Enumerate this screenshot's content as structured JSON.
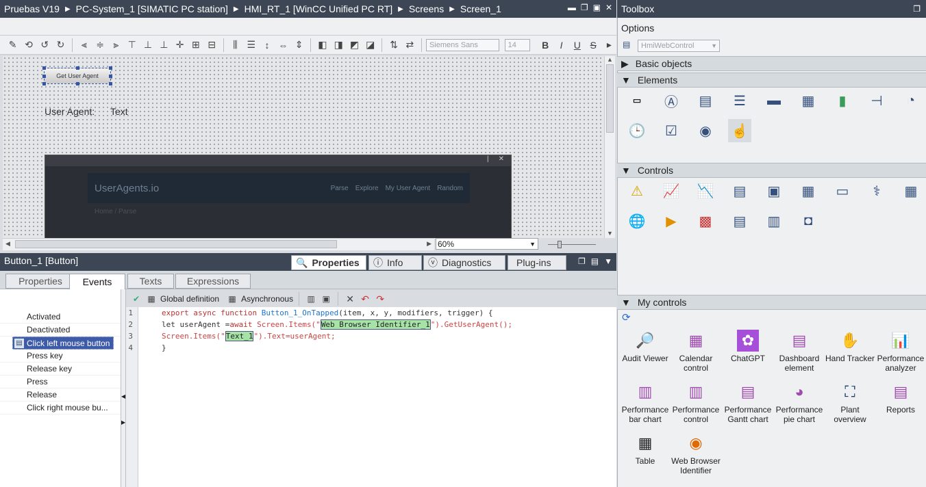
{
  "titlebar": {
    "crumbs": [
      "Pruebas V19",
      "PC-System_1 [SIMATIC PC station]",
      "HMI_RT_1 [WinCC Unified PC RT]",
      "Screens",
      "Screen_1"
    ]
  },
  "toolbar": {
    "font_name": "Siemens Sans",
    "font_size": "14",
    "bold": "B",
    "italic": "I",
    "underline": "U",
    "strike": "S"
  },
  "canvas": {
    "button_label": "Get User Agent",
    "ua_label": "User Agent:",
    "ua_text": "Text",
    "web": {
      "brand": "UserAgents.io",
      "links": [
        "Parse",
        "Explore",
        "My User Agent",
        "Random"
      ],
      "breadcrumb": "Home / Parse"
    }
  },
  "zoom": {
    "value": "60%"
  },
  "properties": {
    "title": "Button_1 [Button]",
    "tabs": [
      "Properties",
      "Info",
      "Diagnostics",
      "Plug-ins"
    ],
    "subtabs": [
      "Properties",
      "Events",
      "Texts",
      "Expressions"
    ]
  },
  "events": [
    "Activated",
    "Deactivated",
    "Click left mouse button",
    "Press key",
    "Release key",
    "Press",
    "Release",
    "Click right mouse bu..."
  ],
  "code_toolbar": {
    "global_def": "Global definition",
    "async": "Asynchronous"
  },
  "code": {
    "line1": {
      "n": "1",
      "a": "export async function",
      "b": " Button_1_OnTapped",
      "c": "(item, x, y, modifiers, trigger) {"
    },
    "line2": {
      "n": "2",
      "a": "let userAgent =",
      "b": "await",
      "c": " Screen.Items(\"",
      "d": "Web Browser Identifier_1",
      "e": "\").GetUserAgent();"
    },
    "line3": {
      "n": "3",
      "a": "Screen.Items(\"",
      "b": "Text_1",
      "c": "\").Text=userAgent;"
    },
    "line4": {
      "n": "4",
      "a": "}"
    }
  },
  "toolbox": {
    "title": "Toolbox",
    "options": "Options",
    "control_select": "HmiWebControl",
    "sections": {
      "basic": "Basic objects",
      "elements": "Elements",
      "controls": "Controls",
      "my": "My controls"
    },
    "my_controls": [
      {
        "l1": "Audit Viewer",
        "l2": ""
      },
      {
        "l1": "Calendar",
        "l2": "control"
      },
      {
        "l1": "ChatGPT",
        "l2": ""
      },
      {
        "l1": "Dashboard",
        "l2": "element"
      },
      {
        "l1": "Hand Tracker",
        "l2": ""
      },
      {
        "l1": "Performance",
        "l2": "analyzer"
      },
      {
        "l1": "Performance",
        "l2": "bar chart"
      },
      {
        "l1": "Performance",
        "l2": "control"
      },
      {
        "l1": "Performance",
        "l2": "Gantt chart"
      },
      {
        "l1": "Performance",
        "l2": "pie chart"
      },
      {
        "l1": "Plant",
        "l2": "overview"
      },
      {
        "l1": "Reports",
        "l2": ""
      },
      {
        "l1": "Table",
        "l2": ""
      },
      {
        "l1": "Web Browser",
        "l2": "Identifier"
      }
    ]
  },
  "colors": {
    "titlebar": "#3c4655",
    "selection": "#3d5ba9",
    "highlight": "#a6e3a6"
  }
}
